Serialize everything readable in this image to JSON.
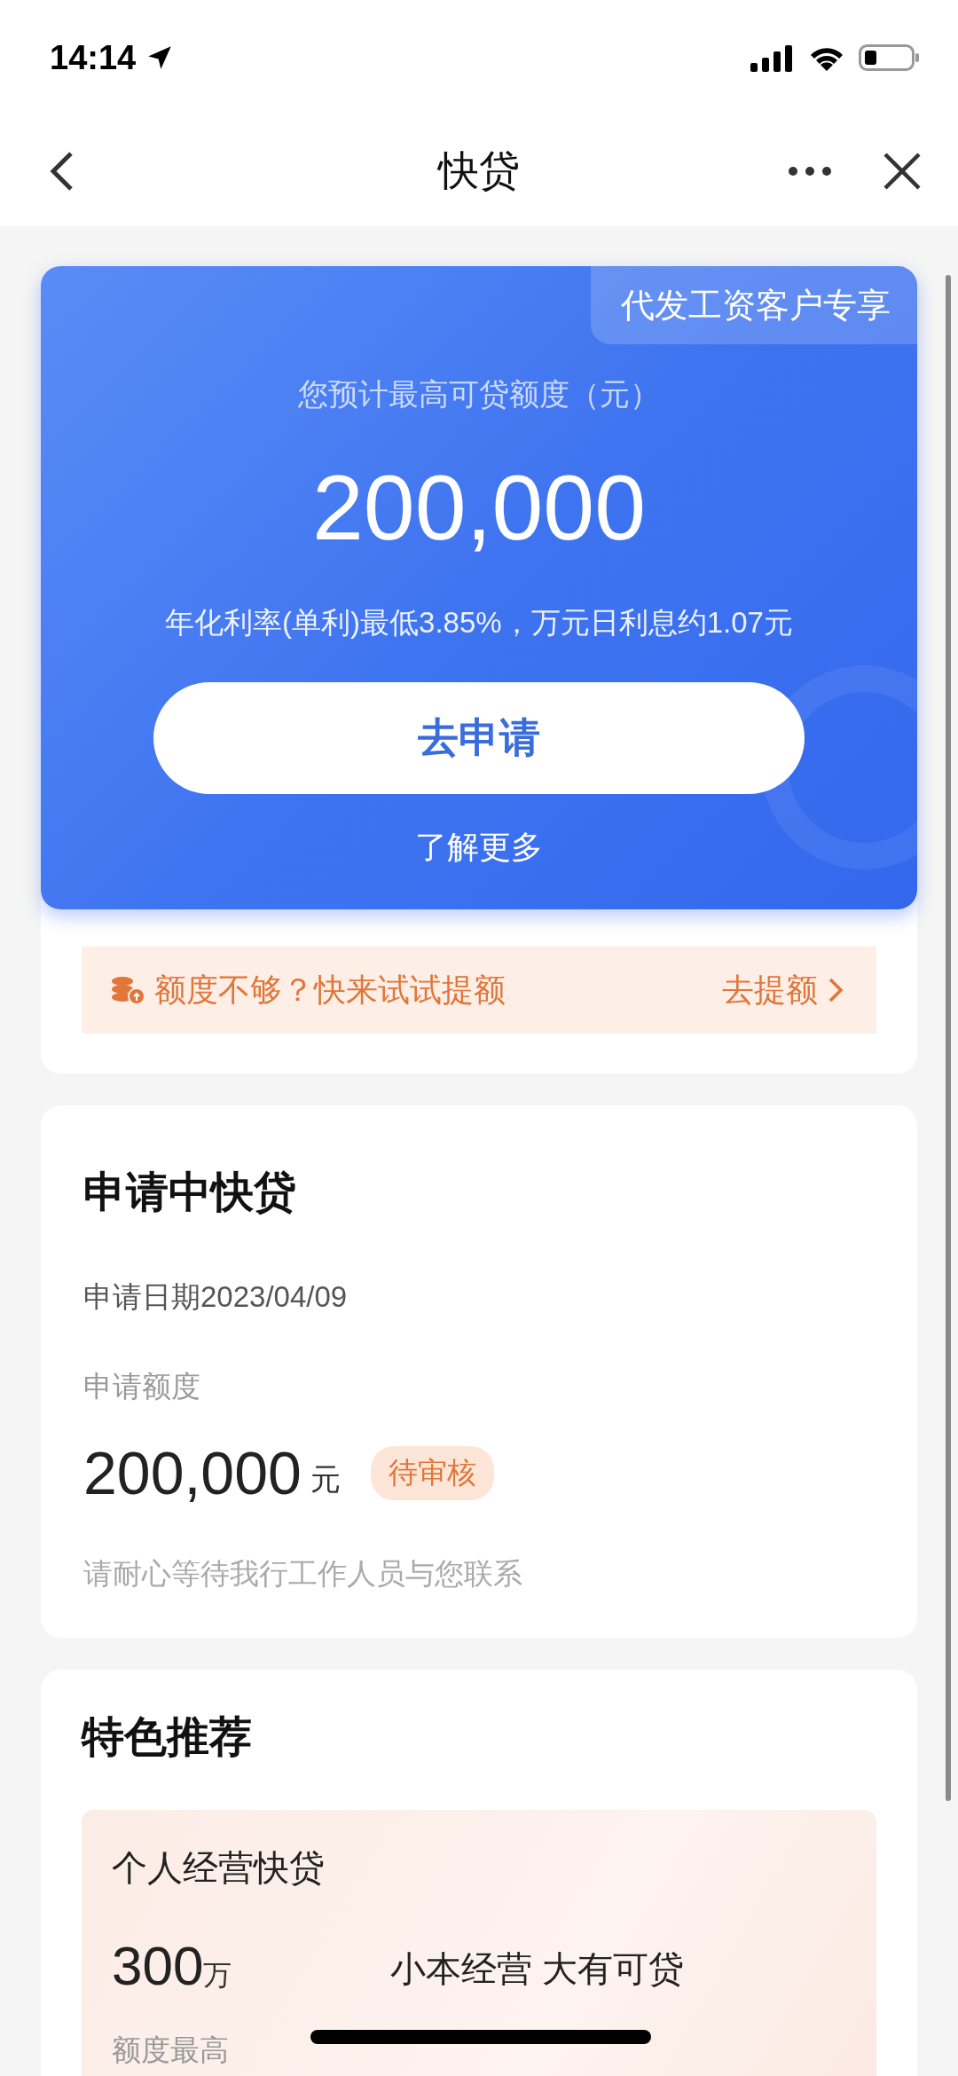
{
  "status_bar": {
    "time": "14:14"
  },
  "nav": {
    "title": "快贷"
  },
  "quota_card": {
    "badge": "代发工资客户专享",
    "label": "您预计最高可贷额度（元）",
    "amount": "200,000",
    "rate_note": "年化利率(单利)最低3.85%，万元日利息约1.07元",
    "apply_button": "去申请",
    "learn_more": "了解更多"
  },
  "promo_bar": {
    "text": "额度不够？快来试试提额",
    "action": "去提额"
  },
  "application": {
    "title": "申请中快贷",
    "date": "申请日期2023/04/09",
    "amount_label": "申请额度",
    "amount": "200,000",
    "unit": "元",
    "status": "待审核",
    "note": "请耐心等待我行工作人员与您联系"
  },
  "recommend": {
    "title": "特色推荐",
    "products": [
      {
        "name": "个人经营快贷",
        "amount": "300",
        "unit": "万",
        "amount_label": "额度最高",
        "slogan": "小本经营 大有可贷"
      }
    ]
  }
}
